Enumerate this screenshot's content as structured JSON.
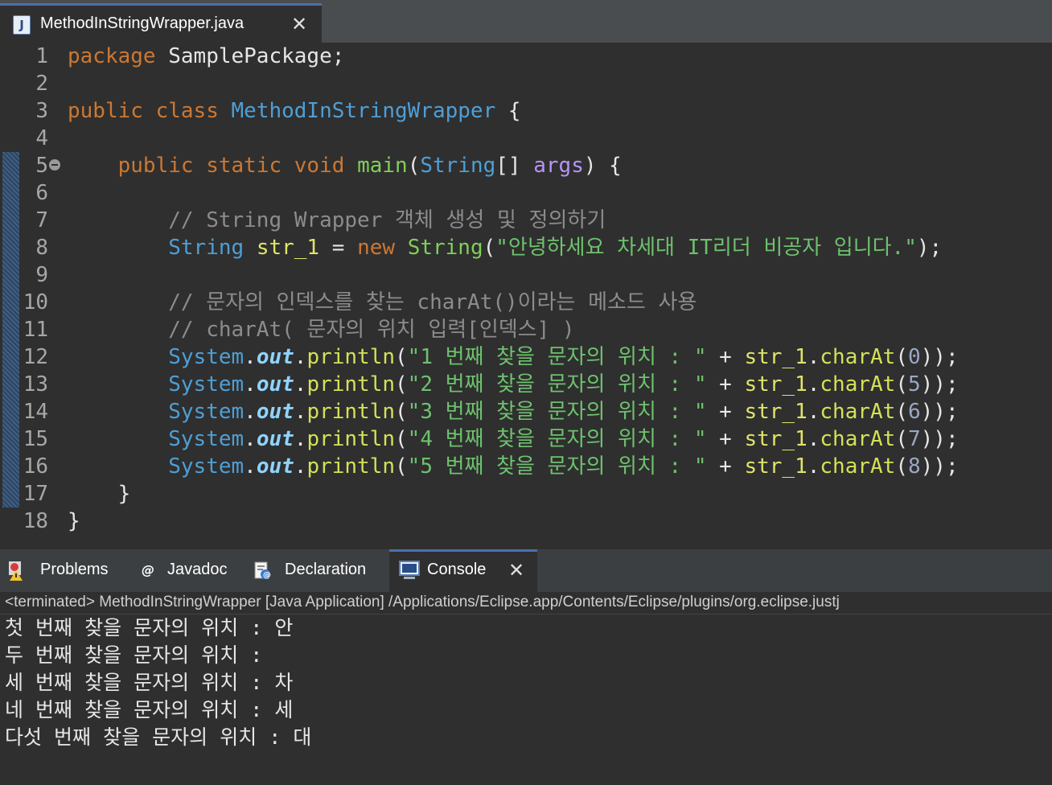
{
  "editor_tab": {
    "icon": "java-file-icon",
    "icon_letter": "J",
    "filename": "MethodInStringWrapper.java",
    "close": "✕"
  },
  "code": {
    "line_numbers": [
      "1",
      "2",
      "3",
      "4",
      "5",
      "6",
      "7",
      "8",
      "9",
      "10",
      "11",
      "12",
      "13",
      "14",
      "15",
      "16",
      "17",
      "18"
    ],
    "l1": {
      "kw": "package",
      "pkg": "SamplePackage;"
    },
    "l3": {
      "kw1": "public",
      "kw2": "class",
      "cls": "MethodInStringWrapper",
      "brace": "{"
    },
    "l5": {
      "kw1": "public",
      "kw2": "static",
      "kw3": "void",
      "name": "main",
      "p1": "(",
      "type": "String",
      "arr": "[]",
      "arg": "args",
      "end": ") {"
    },
    "l7": {
      "comment": "// String Wrapper 객체 생성 및 정의하기"
    },
    "l8": {
      "type": "String",
      "var": "str_1",
      "eq": "=",
      "kw": "new",
      "ctor": "String",
      "p1": "(",
      "str": "\"안녕하세요 차세대 IT리더 비공자 입니다.\"",
      "end": ");"
    },
    "l10": {
      "comment": "// 문자의 인덱스를 찾는 charAt()이라는 메소드 사용"
    },
    "l11": {
      "comment": "// charAt( 문자의 위치 입력[인덱스] )"
    },
    "println_lines": [
      {
        "sys": "System",
        "out": "out",
        "m": "println",
        "str": "\"1 번째 찾을 문자의 위치 : \"",
        "plus": "+",
        "var": "str_1",
        "call": "charAt",
        "idx": "0"
      },
      {
        "sys": "System",
        "out": "out",
        "m": "println",
        "str": "\"2 번째 찾을 문자의 위치 : \"",
        "plus": "+",
        "var": "str_1",
        "call": "charAt",
        "idx": "5"
      },
      {
        "sys": "System",
        "out": "out",
        "m": "println",
        "str": "\"3 번째 찾을 문자의 위치 : \"",
        "plus": "+",
        "var": "str_1",
        "call": "charAt",
        "idx": "6"
      },
      {
        "sys": "System",
        "out": "out",
        "m": "println",
        "str": "\"4 번째 찾을 문자의 위치 : \"",
        "plus": "+",
        "var": "str_1",
        "call": "charAt",
        "idx": "7"
      },
      {
        "sys": "System",
        "out": "out",
        "m": "println",
        "str": "\"5 번째 찾을 문자의 위치 : \"",
        "plus": "+",
        "var": "str_1",
        "call": "charAt",
        "idx": "8"
      }
    ],
    "l17": {
      "brace": "}"
    },
    "l18": {
      "brace": "}"
    }
  },
  "panel_tabs": [
    {
      "label": "Problems",
      "icon": "problems-icon"
    },
    {
      "label": "Javadoc",
      "icon": "javadoc-icon",
      "glyph": "@"
    },
    {
      "label": "Declaration",
      "icon": "declaration-icon"
    },
    {
      "label": "Console",
      "icon": "console-icon",
      "close": "✕"
    }
  ],
  "console": {
    "status": "<terminated> MethodInStringWrapper [Java Application] /Applications/Eclipse.app/Contents/Eclipse/plugins/org.eclipse.justj",
    "output": [
      "첫 번째 찾을 문자의 위치 : 안",
      "두 번째 찾을 문자의 위치 :",
      "세 번째 찾을 문자의 위치 : 차",
      "네 번째 찾을 문자의 위치 : 세",
      "다섯 번째 찾을 문자의 위치 : 대"
    ]
  },
  "colors": {
    "editor_bg": "#2f2f2f",
    "keyword": "#cc7832",
    "type": "#4e9fd6",
    "string": "#6ec16e",
    "comment": "#8c8c8c",
    "accent": "#4b6eaf"
  }
}
